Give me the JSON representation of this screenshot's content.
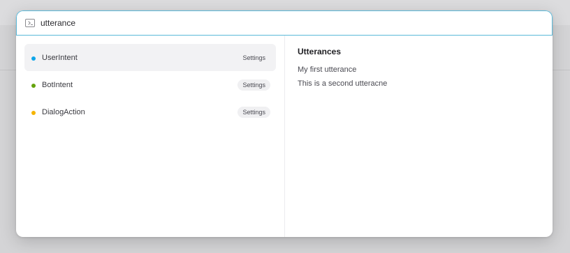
{
  "search": {
    "value": "utterance",
    "icon": "terminal-icon"
  },
  "list": {
    "items": [
      {
        "label": "UserIntent",
        "badge": "Settings",
        "dot_color": "#0ea5e9",
        "selected": true
      },
      {
        "label": "BotIntent",
        "badge": "Settings",
        "dot_color": "#65a30d",
        "selected": false
      },
      {
        "label": "DialogAction",
        "badge": "Settings",
        "dot_color": "#f5b400",
        "selected": false
      }
    ]
  },
  "detail": {
    "title": "Utterances",
    "utterances": [
      "My first utterance",
      "This is a second utteracne"
    ]
  },
  "colors": {
    "search_border": "#5ab8d8",
    "selected_bg": "#f2f2f4"
  }
}
